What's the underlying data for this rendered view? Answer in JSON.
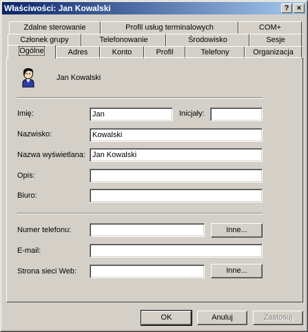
{
  "window": {
    "title": "Właściwości: Jan Kowalski",
    "help_label": "?",
    "close_label": "×"
  },
  "tabs": {
    "row1": [
      "Zdalne sterowanie",
      "Profil usług terminalowych",
      "COM+"
    ],
    "row2": [
      "Członek grupy",
      "Telefonowanie",
      "Środowisko",
      "Sesje"
    ],
    "row3": [
      "Ogólne",
      "Adres",
      "Konto",
      "Profil",
      "Telefony",
      "Organizacja"
    ],
    "active": "Ogólne"
  },
  "user": {
    "display": "Jan Kowalski",
    "icon": "user-icon"
  },
  "form": {
    "first_name_label": "Imię:",
    "first_name_value": "Jan",
    "initials_label": "Inicjały:",
    "initials_value": "",
    "last_name_label": "Nazwisko:",
    "last_name_value": "Kowalski",
    "display_name_label": "Nazwa wyświetlana:",
    "display_name_value": "Jan Kowalski",
    "description_label": "Opis:",
    "description_value": "",
    "office_label": "Biuro:",
    "office_value": "",
    "phone_label": "Numer telefonu:",
    "phone_value": "",
    "email_label": "E-mail:",
    "email_value": "",
    "web_label": "Strona sieci Web:",
    "web_value": "",
    "other_label": "Inne..."
  },
  "buttons": {
    "ok": "OK",
    "cancel": "Anuluj",
    "apply": "Zastosuj"
  }
}
